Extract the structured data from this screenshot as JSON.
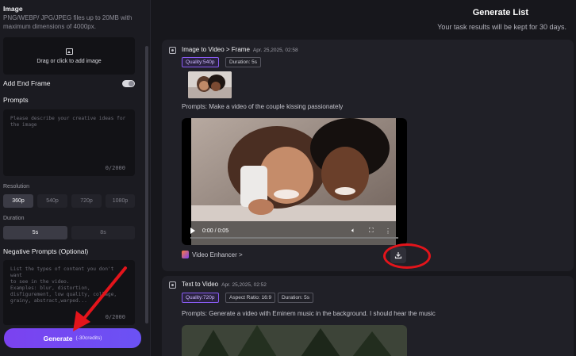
{
  "sidebar": {
    "image": {
      "title": "Image",
      "hint_line1": "PNG/WEBP/ JPG/JPEG files up to 20MB with",
      "hint_line2": "maximum dimensions of 4000px.",
      "upload_label": "Drag or click to add image"
    },
    "end_frame": {
      "label": "Add End Frame",
      "enabled": true
    },
    "prompts": {
      "title": "Prompts",
      "placeholder_line1": "Please describe your creative ideas for",
      "placeholder_line2": "the image",
      "counter": "0/2000"
    },
    "resolution": {
      "label": "Resolution",
      "options": [
        "360p",
        "540p",
        "720p",
        "1080p"
      ],
      "selected": "360p"
    },
    "duration": {
      "label": "Duration",
      "options": [
        "5s",
        "8s"
      ],
      "selected": "5s"
    },
    "negative": {
      "title": "Negative Prompts (Optional)",
      "lines": [
        "List the types of content you don't want",
        "to see in the video.",
        "Examples: blur, distortion,",
        "disfigurement, low quality, collage,",
        "grainy,  abstract,warped..."
      ],
      "counter": "0/2000"
    },
    "generate": {
      "label": "Generate",
      "credits": "(-30credits)"
    }
  },
  "list": {
    "title": "Generate List",
    "subtitle": "Your task results will be kept for 30 days."
  },
  "tasks": [
    {
      "title": "Image to Video > Frame",
      "date": "Apr. 25,2025, 02:58",
      "tags": [
        "Quality:540p",
        "Duration: 5s"
      ],
      "prompt": "Prompts:  Make a video of the couple kissing passionately",
      "time_display": "0:00 / 0:05",
      "enhancer_label": "Video Enhancer >"
    },
    {
      "title": "Text to Video",
      "date": "Apr. 25,2025, 02:52",
      "tags": [
        "Quality:720p",
        "Aspect Ratio: 16:9",
        "Duration: 5s"
      ],
      "prompt": "Prompts:  Generate a video with Eminem music in the background. I should hear the music"
    }
  ],
  "colors": {
    "accent": "#7b42f0",
    "highlight_ring": "#e3141b",
    "background": "#17171c"
  }
}
